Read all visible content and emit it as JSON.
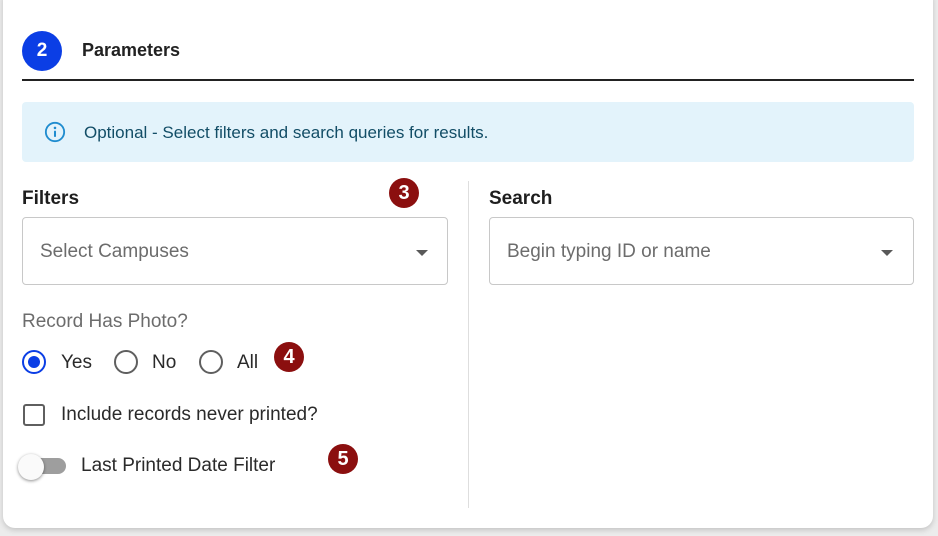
{
  "step": {
    "number": "2",
    "title": "Parameters"
  },
  "info_banner": {
    "icon": "info-circle-icon",
    "text": "Optional - Select filters and search queries for results.",
    "color": "#e3f3fb"
  },
  "filters": {
    "heading": "Filters",
    "campus_select": {
      "placeholder": "Select Campuses",
      "icon": "caret-down-icon"
    },
    "photo_group": {
      "label": "Record Has Photo?",
      "options": [
        {
          "label": "Yes",
          "selected": true
        },
        {
          "label": "No",
          "selected": false
        },
        {
          "label": "All",
          "selected": false
        }
      ]
    },
    "never_printed": {
      "label": "Include records never printed?",
      "checked": false
    },
    "last_printed_toggle": {
      "label": "Last Printed Date Filter",
      "on": false
    }
  },
  "search": {
    "heading": "Search",
    "placeholder": "Begin typing ID or name",
    "icon": "caret-down-icon"
  },
  "callouts": [
    "3",
    "4",
    "5"
  ],
  "colors": {
    "accent": "#0b3ee5",
    "callout": "#8b0f0f"
  }
}
